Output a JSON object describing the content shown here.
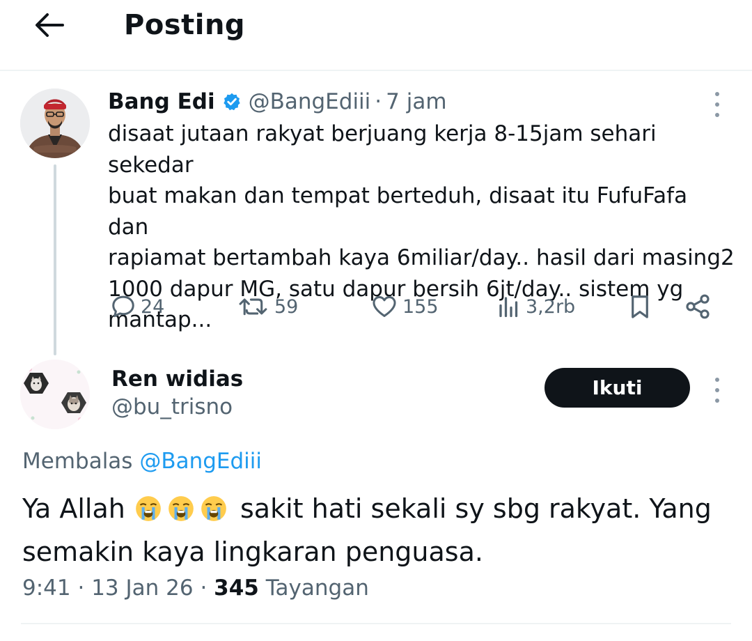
{
  "header": {
    "title": "Posting",
    "back_icon": "arrow-left-icon"
  },
  "post": {
    "author_name": "Bang Edi",
    "verified": true,
    "handle": "@BangEdiii",
    "separator": "·",
    "time": "7 jam",
    "text": "disaat jutaan rakyat berjuang kerja 8-15jam sehari sekedar\nbuat makan dan tempat berteduh, disaat itu FufuFafa dan\nrapiamat bertambah kaya 6miliar/day.. hasil dari masing2\n1000 dapur MG, satu dapur bersih 6jt/day.. sistem yg\nmantap...",
    "actions": {
      "replies": "24",
      "reposts": "59",
      "likes": "155",
      "views": "3,2rb"
    }
  },
  "reply": {
    "author_name": "Ren widias",
    "handle": "@bu_trisno",
    "follow_label": "Ikuti",
    "replying_to_label": "Membalas",
    "replying_to_handle": "@BangEdiii",
    "text_before": "Ya Allah",
    "text_after": " sakit hati sekali sy sbg rakyat. Yang semakin kaya lingkaran penguasa.",
    "emoji_name": "loudly-crying-face",
    "emoji_count": 3,
    "time": "9:41",
    "date": "13 Jan 26",
    "views_count": "345",
    "views_label": "Tayangan"
  },
  "colors": {
    "text": "#0f1419",
    "secondary": "#536471",
    "link": "#1d9bf0",
    "verified": "#1d9bf0",
    "divider": "#eff3f4",
    "thread_line": "#cfd9de",
    "button_bg": "#0f1419"
  }
}
